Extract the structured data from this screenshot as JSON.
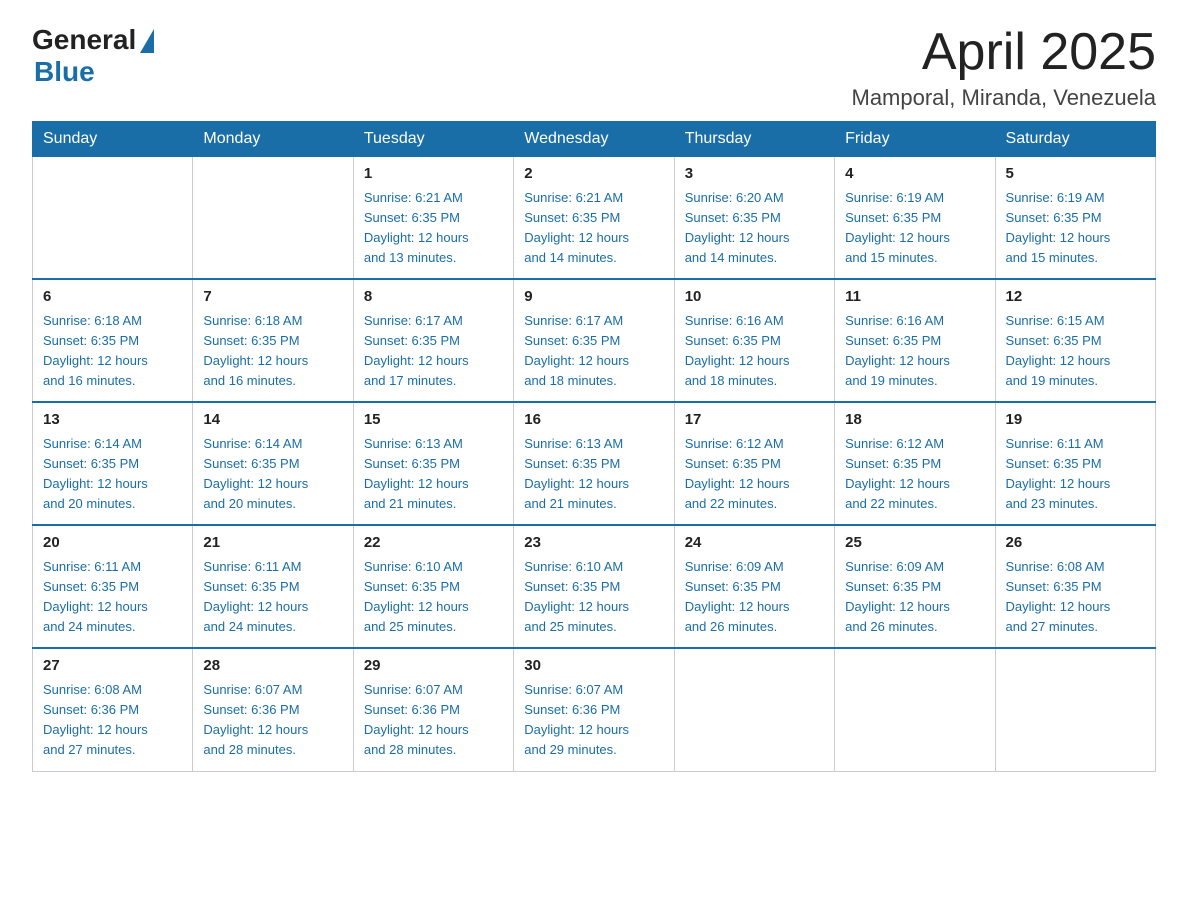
{
  "logo": {
    "general": "General",
    "blue": "Blue"
  },
  "title": "April 2025",
  "location": "Mamporal, Miranda, Venezuela",
  "days_of_week": [
    "Sunday",
    "Monday",
    "Tuesday",
    "Wednesday",
    "Thursday",
    "Friday",
    "Saturday"
  ],
  "weeks": [
    [
      {
        "num": "",
        "info": ""
      },
      {
        "num": "",
        "info": ""
      },
      {
        "num": "1",
        "info": "Sunrise: 6:21 AM\nSunset: 6:35 PM\nDaylight: 12 hours\nand 13 minutes."
      },
      {
        "num": "2",
        "info": "Sunrise: 6:21 AM\nSunset: 6:35 PM\nDaylight: 12 hours\nand 14 minutes."
      },
      {
        "num": "3",
        "info": "Sunrise: 6:20 AM\nSunset: 6:35 PM\nDaylight: 12 hours\nand 14 minutes."
      },
      {
        "num": "4",
        "info": "Sunrise: 6:19 AM\nSunset: 6:35 PM\nDaylight: 12 hours\nand 15 minutes."
      },
      {
        "num": "5",
        "info": "Sunrise: 6:19 AM\nSunset: 6:35 PM\nDaylight: 12 hours\nand 15 minutes."
      }
    ],
    [
      {
        "num": "6",
        "info": "Sunrise: 6:18 AM\nSunset: 6:35 PM\nDaylight: 12 hours\nand 16 minutes."
      },
      {
        "num": "7",
        "info": "Sunrise: 6:18 AM\nSunset: 6:35 PM\nDaylight: 12 hours\nand 16 minutes."
      },
      {
        "num": "8",
        "info": "Sunrise: 6:17 AM\nSunset: 6:35 PM\nDaylight: 12 hours\nand 17 minutes."
      },
      {
        "num": "9",
        "info": "Sunrise: 6:17 AM\nSunset: 6:35 PM\nDaylight: 12 hours\nand 18 minutes."
      },
      {
        "num": "10",
        "info": "Sunrise: 6:16 AM\nSunset: 6:35 PM\nDaylight: 12 hours\nand 18 minutes."
      },
      {
        "num": "11",
        "info": "Sunrise: 6:16 AM\nSunset: 6:35 PM\nDaylight: 12 hours\nand 19 minutes."
      },
      {
        "num": "12",
        "info": "Sunrise: 6:15 AM\nSunset: 6:35 PM\nDaylight: 12 hours\nand 19 minutes."
      }
    ],
    [
      {
        "num": "13",
        "info": "Sunrise: 6:14 AM\nSunset: 6:35 PM\nDaylight: 12 hours\nand 20 minutes."
      },
      {
        "num": "14",
        "info": "Sunrise: 6:14 AM\nSunset: 6:35 PM\nDaylight: 12 hours\nand 20 minutes."
      },
      {
        "num": "15",
        "info": "Sunrise: 6:13 AM\nSunset: 6:35 PM\nDaylight: 12 hours\nand 21 minutes."
      },
      {
        "num": "16",
        "info": "Sunrise: 6:13 AM\nSunset: 6:35 PM\nDaylight: 12 hours\nand 21 minutes."
      },
      {
        "num": "17",
        "info": "Sunrise: 6:12 AM\nSunset: 6:35 PM\nDaylight: 12 hours\nand 22 minutes."
      },
      {
        "num": "18",
        "info": "Sunrise: 6:12 AM\nSunset: 6:35 PM\nDaylight: 12 hours\nand 22 minutes."
      },
      {
        "num": "19",
        "info": "Sunrise: 6:11 AM\nSunset: 6:35 PM\nDaylight: 12 hours\nand 23 minutes."
      }
    ],
    [
      {
        "num": "20",
        "info": "Sunrise: 6:11 AM\nSunset: 6:35 PM\nDaylight: 12 hours\nand 24 minutes."
      },
      {
        "num": "21",
        "info": "Sunrise: 6:11 AM\nSunset: 6:35 PM\nDaylight: 12 hours\nand 24 minutes."
      },
      {
        "num": "22",
        "info": "Sunrise: 6:10 AM\nSunset: 6:35 PM\nDaylight: 12 hours\nand 25 minutes."
      },
      {
        "num": "23",
        "info": "Sunrise: 6:10 AM\nSunset: 6:35 PM\nDaylight: 12 hours\nand 25 minutes."
      },
      {
        "num": "24",
        "info": "Sunrise: 6:09 AM\nSunset: 6:35 PM\nDaylight: 12 hours\nand 26 minutes."
      },
      {
        "num": "25",
        "info": "Sunrise: 6:09 AM\nSunset: 6:35 PM\nDaylight: 12 hours\nand 26 minutes."
      },
      {
        "num": "26",
        "info": "Sunrise: 6:08 AM\nSunset: 6:35 PM\nDaylight: 12 hours\nand 27 minutes."
      }
    ],
    [
      {
        "num": "27",
        "info": "Sunrise: 6:08 AM\nSunset: 6:36 PM\nDaylight: 12 hours\nand 27 minutes."
      },
      {
        "num": "28",
        "info": "Sunrise: 6:07 AM\nSunset: 6:36 PM\nDaylight: 12 hours\nand 28 minutes."
      },
      {
        "num": "29",
        "info": "Sunrise: 6:07 AM\nSunset: 6:36 PM\nDaylight: 12 hours\nand 28 minutes."
      },
      {
        "num": "30",
        "info": "Sunrise: 6:07 AM\nSunset: 6:36 PM\nDaylight: 12 hours\nand 29 minutes."
      },
      {
        "num": "",
        "info": ""
      },
      {
        "num": "",
        "info": ""
      },
      {
        "num": "",
        "info": ""
      }
    ]
  ]
}
